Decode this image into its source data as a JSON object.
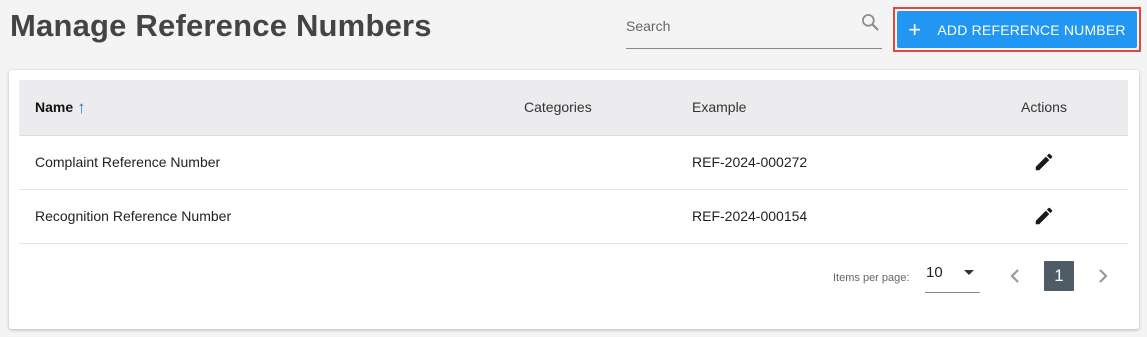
{
  "header": {
    "title": "Manage Reference Numbers"
  },
  "search": {
    "placeholder": "Search",
    "value": ""
  },
  "toolbar": {
    "add_label": "ADD REFERENCE NUMBER",
    "add_icon": "plus-icon"
  },
  "table": {
    "columns": {
      "name": "Name",
      "categories": "Categories",
      "example": "Example",
      "actions": "Actions"
    },
    "sort": {
      "column": "name",
      "direction": "ascending"
    },
    "rows": [
      {
        "name": "Complaint Reference Number",
        "categories": "",
        "example": "REF-2024-000272",
        "action_icon": "edit-pencil-icon"
      },
      {
        "name": "Recognition Reference Number",
        "categories": "",
        "example": "REF-2024-000154",
        "action_icon": "edit-pencil-icon"
      }
    ]
  },
  "pagination": {
    "items_per_page_label": "Items per page:",
    "items_per_page": "10",
    "current_page": "1"
  },
  "colors": {
    "accent": "#2196f3",
    "highlight_border": "#e2473f",
    "sort_arrow": "#1e7bd8",
    "active_page": "#4f5b66"
  }
}
